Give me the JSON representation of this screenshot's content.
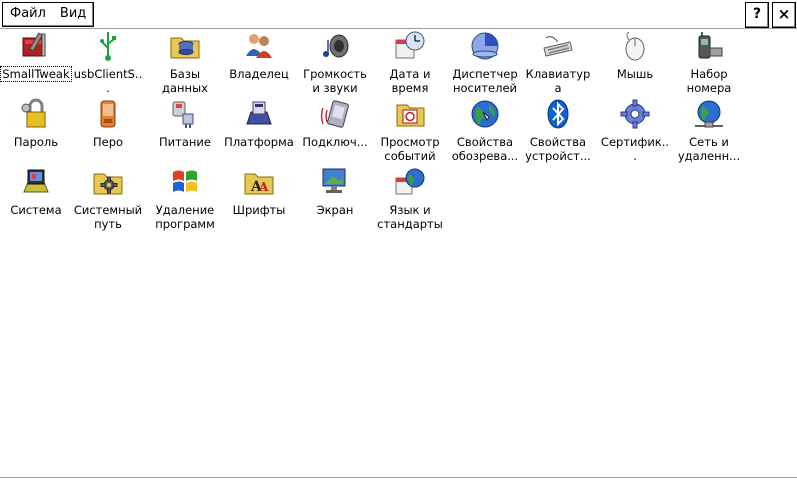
{
  "menu": {
    "file_label": "Файл",
    "view_label": "Вид",
    "help_label": "?",
    "close_label": "×"
  },
  "items": [
    {
      "label": "SmallTweak",
      "icon": "tweak-tools-icon"
    },
    {
      "label": "usbClientS...",
      "icon": "usb-icon"
    },
    {
      "label": "Базы данных",
      "icon": "database-folder-icon"
    },
    {
      "label": "Владелец",
      "icon": "owner-people-icon"
    },
    {
      "label": "Громкость и звуки",
      "icon": "speaker-icon"
    },
    {
      "label": "Дата и время",
      "icon": "calendar-clock-icon"
    },
    {
      "label": "Диспетчер носителей",
      "icon": "disk-manager-icon"
    },
    {
      "label": "Клавиатура",
      "icon": "keyboard-icon"
    },
    {
      "label": "Мышь",
      "icon": "mouse-icon"
    },
    {
      "label": "Набор номера",
      "icon": "phone-dialing-icon"
    },
    {
      "label": "Пароль",
      "icon": "password-lock-icon"
    },
    {
      "label": "Перо",
      "icon": "stylus-device-icon"
    },
    {
      "label": "Питание",
      "icon": "power-plug-icon"
    },
    {
      "label": "Платформа",
      "icon": "platform-icon"
    },
    {
      "label": "Подключ...",
      "icon": "connection-device-icon"
    },
    {
      "label": "Просмотр событий",
      "icon": "event-viewer-icon"
    },
    {
      "label": "Свойства обозрева...",
      "icon": "browser-globe-icon"
    },
    {
      "label": "Свойства устройст...",
      "icon": "bluetooth-icon"
    },
    {
      "label": "Сертифик...",
      "icon": "certificate-gear-icon"
    },
    {
      "label": "Сеть и удаленн...",
      "icon": "network-globe-icon"
    },
    {
      "label": "Система",
      "icon": "system-icon"
    },
    {
      "label": "Системный путь",
      "icon": "system-path-folder-icon"
    },
    {
      "label": "Удаление программ",
      "icon": "remove-programs-icon"
    },
    {
      "label": "Шрифты",
      "icon": "fonts-folder-icon"
    },
    {
      "label": "Экран",
      "icon": "display-icon"
    },
    {
      "label": "Язык и стандарты",
      "icon": "language-globe-icon"
    }
  ],
  "colors": {
    "folder": "#e8c850",
    "globe_blue": "#2a6fd0",
    "globe_green": "#3aa040",
    "bluetooth": "#1060d0",
    "gear": "#6a7fd8"
  }
}
